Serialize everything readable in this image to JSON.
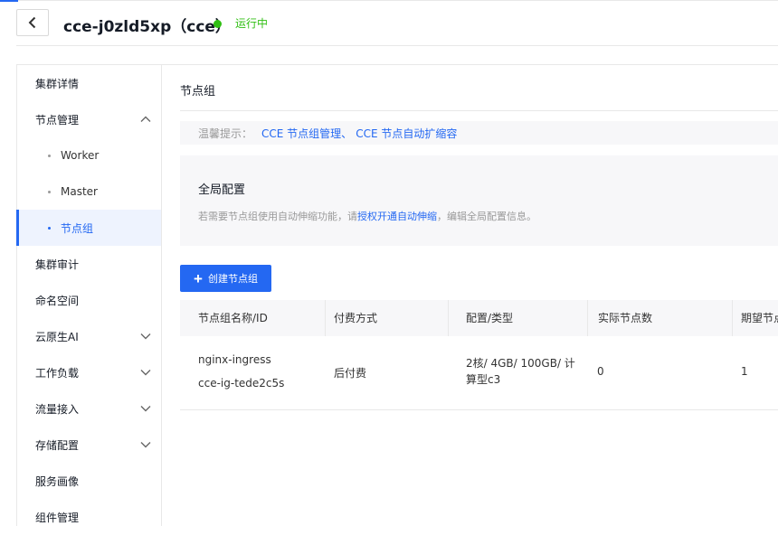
{
  "header": {
    "title": "cce-j0zld5xp（cce）",
    "status": "运行中"
  },
  "sidebar": {
    "items": [
      {
        "label": "集群详情"
      },
      {
        "label": "节点管理"
      },
      {
        "label": "Worker"
      },
      {
        "label": "Master"
      },
      {
        "label": "节点组"
      },
      {
        "label": "集群审计"
      },
      {
        "label": "命名空间"
      },
      {
        "label": "云原生AI"
      },
      {
        "label": "工作负载"
      },
      {
        "label": "流量接入"
      },
      {
        "label": "存储配置"
      },
      {
        "label": "服务画像"
      },
      {
        "label": "组件管理"
      }
    ]
  },
  "main": {
    "title": "节点组",
    "tip": {
      "label": "温馨提示：",
      "link1": "CCE 节点组管理",
      "separator": "、",
      "link2": "CCE 节点自动扩缩容"
    },
    "global_config": {
      "title": "全局配置",
      "desc_prefix": "若需要节点组使用自动伸缩功能，请",
      "desc_link": "授权开通自动伸缩",
      "desc_suffix": "，编辑全局配置信息。"
    },
    "create_button": "创建节点组",
    "table": {
      "columns": [
        "节点组名称/ID",
        "付费方式",
        "配置/类型",
        "实际节点数",
        "期望节点数"
      ],
      "rows": [
        {
          "name": "nginx-ingress",
          "id": "cce-ig-tede2c5s",
          "billing": "后付费",
          "spec": "2核/ 4GB/ 100GB/ 计算型c3",
          "actual": "0",
          "expected": "1"
        }
      ]
    }
  }
}
